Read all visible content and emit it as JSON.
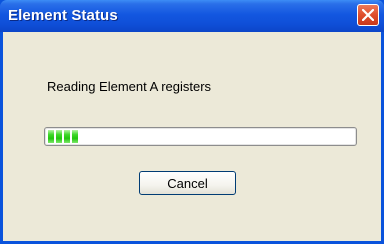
{
  "window": {
    "title": "Element Status",
    "close_icon": "close-icon"
  },
  "dialog": {
    "message": "Reading Element A registers",
    "progress": {
      "fraction": 0.16,
      "visible_chunks": 4
    },
    "cancel_label": "Cancel"
  },
  "colors": {
    "titlebar": "#0f4fd8",
    "close_button": "#df4d2c",
    "dialog_background": "#ece9d8",
    "progress_fill": "#22c60e"
  }
}
